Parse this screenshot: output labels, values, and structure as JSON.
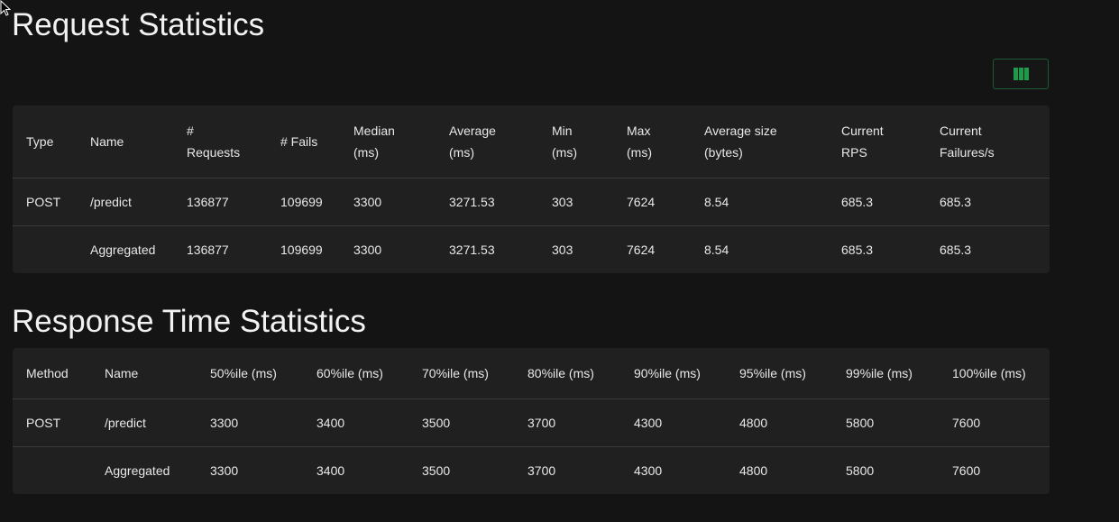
{
  "request_statistics": {
    "title": "Request Statistics",
    "columns_button_icon": "columns-icon",
    "headers": [
      {
        "line1": "Type",
        "line2": ""
      },
      {
        "line1": "Name",
        "line2": ""
      },
      {
        "line1": "#",
        "line2": "Requests"
      },
      {
        "line1": "# Fails",
        "line2": ""
      },
      {
        "line1": "Median",
        "line2": "(ms)"
      },
      {
        "line1": "Average",
        "line2": "(ms)"
      },
      {
        "line1": "Min",
        "line2": "(ms)"
      },
      {
        "line1": "Max",
        "line2": "(ms)"
      },
      {
        "line1": "Average size",
        "line2": "(bytes)"
      },
      {
        "line1": "Current",
        "line2": "RPS"
      },
      {
        "line1": "Current",
        "line2": "Failures/s"
      }
    ],
    "rows": [
      [
        "POST",
        "/predict",
        "136877",
        "109699",
        "3300",
        "3271.53",
        "303",
        "7624",
        "8.54",
        "685.3",
        "685.3"
      ],
      [
        "",
        "Aggregated",
        "136877",
        "109699",
        "3300",
        "3271.53",
        "303",
        "7624",
        "8.54",
        "685.3",
        "685.3"
      ]
    ]
  },
  "response_time_statistics": {
    "title": "Response Time Statistics",
    "headers": [
      "Method",
      "Name",
      "50%ile (ms)",
      "60%ile (ms)",
      "70%ile (ms)",
      "80%ile (ms)",
      "90%ile (ms)",
      "95%ile (ms)",
      "99%ile (ms)",
      "100%ile (ms)"
    ],
    "rows": [
      [
        "POST",
        "/predict",
        "3300",
        "3400",
        "3500",
        "3700",
        "4300",
        "4800",
        "5800",
        "7600"
      ],
      [
        "",
        "Aggregated",
        "3300",
        "3400",
        "3500",
        "3700",
        "4300",
        "4800",
        "5800",
        "7600"
      ]
    ]
  },
  "colors": {
    "background": "#141414",
    "card": "#202020",
    "accent_green": "#1d9b4a"
  }
}
